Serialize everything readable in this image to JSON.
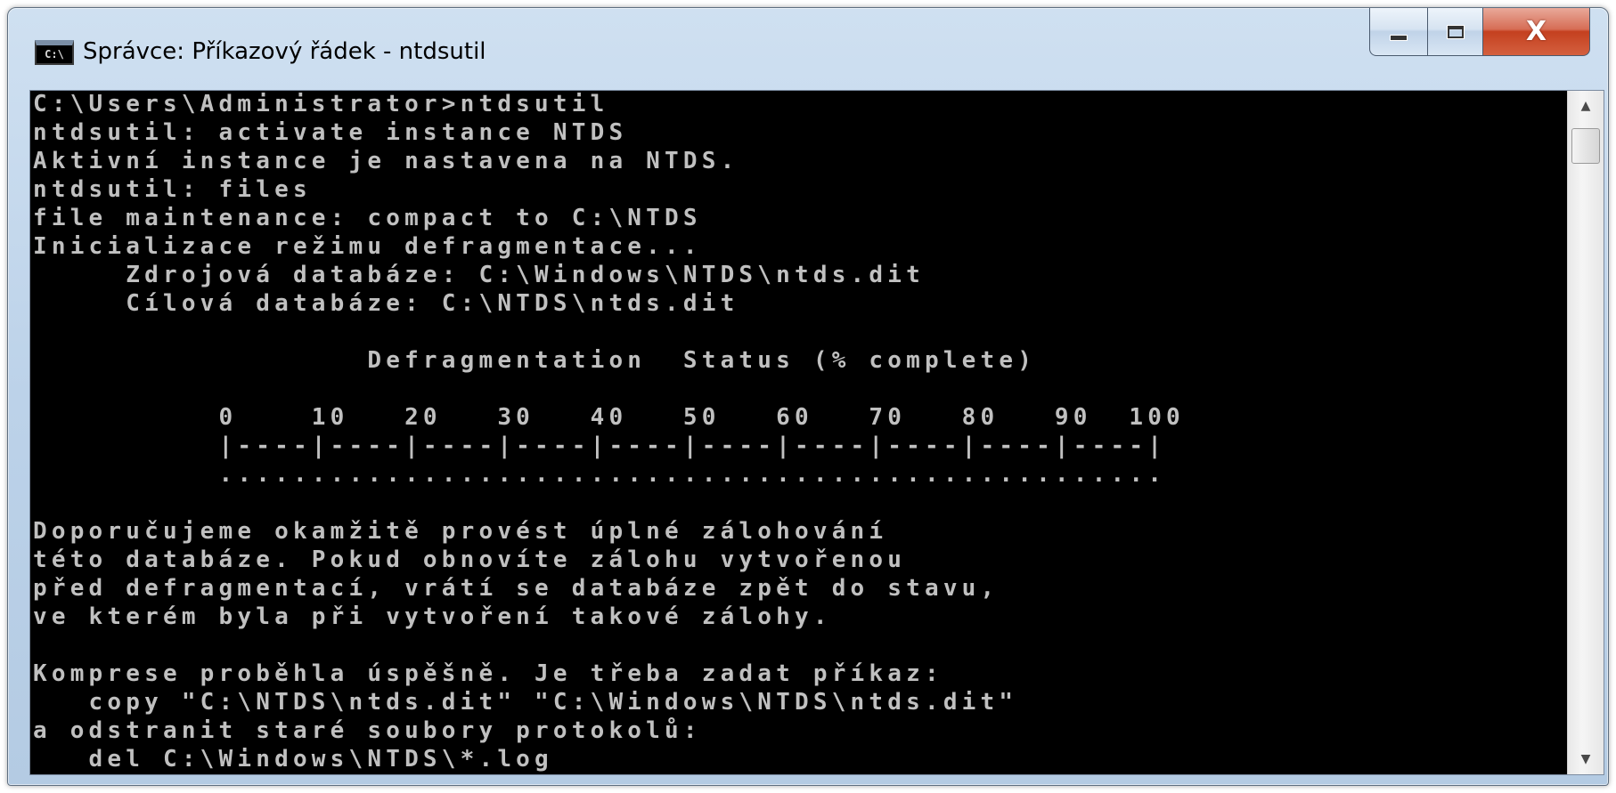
{
  "window": {
    "title": "Správce: Příkazový řádek - ntdsutil",
    "app_icon_text": "C:\\",
    "controls": {
      "minimize_icon": "minimize-icon",
      "maximize_icon": "maximize-icon",
      "close_glyph": "X"
    }
  },
  "console": {
    "text_color": "#c0c0c0",
    "background": "#000000",
    "lines": [
      "C:\\Users\\Administrator>ntdsutil",
      "ntdsutil: activate instance NTDS",
      "Aktivní instance je nastavena na NTDS.",
      "ntdsutil: files",
      "file maintenance: compact to C:\\NTDS",
      "Inicializace režimu defragmentace...",
      "     Zdrojová databáze: C:\\Windows\\NTDS\\ntds.dit",
      "     Cílová databáze: C:\\NTDS\\ntds.dit",
      "",
      "                  Defragmentation  Status (% complete)",
      "",
      "          0    10   20   30   40   50   60   70   80   90  100",
      "          |----|----|----|----|----|----|----|----|----|----|",
      "          ...................................................",
      "",
      "Doporučujeme okamžitě provést úplné zálohování",
      "této databáze. Pokud obnovíte zálohu vytvořenou",
      "před defragmentací, vrátí se databáze zpět do stavu,",
      "ve kterém byla při vytvoření takové zálohy.",
      "",
      "Komprese proběhla úspěšně. Je třeba zadat příkaz:",
      "   copy \"C:\\NTDS\\ntds.dit\" \"C:\\Windows\\NTDS\\ntds.dit\"",
      "a odstranit staré soubory protokolů:",
      "   del C:\\Windows\\NTDS\\*.log"
    ]
  },
  "scrollbar": {
    "up_arrow": "▲",
    "down_arrow": "▼"
  }
}
